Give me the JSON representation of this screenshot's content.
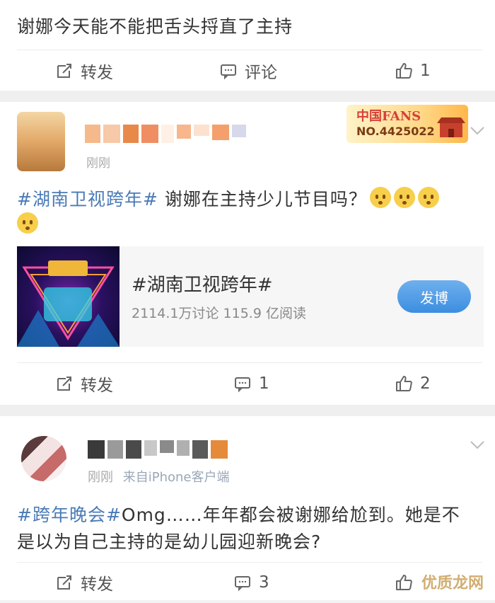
{
  "post1": {
    "text": "谢娜今天能不能把舌头捋直了主持",
    "actions": {
      "repost": "转发",
      "comment": "评论",
      "like": "1"
    }
  },
  "post2": {
    "time": "刚刚",
    "badge": {
      "brand": "中国FANS",
      "number": "NO.4425022"
    },
    "topic": "#湖南卫视跨年#",
    "text": " 谢娜在主持少儿节目吗？",
    "topic_card": {
      "title": "#湖南卫视跨年#",
      "stats": "2114.1万讨论  115.9 亿阅读",
      "button": "发博"
    },
    "actions": {
      "repost": "转发",
      "comment": "1",
      "like": "2"
    }
  },
  "post3": {
    "time": "刚刚",
    "source": "来自iPhone客户端",
    "topic": "#跨年晚会#",
    "text_line1_rest": "Omg……年年都会被谢娜给尬到。她是不",
    "text_line2": "是以为自己主持的是幼儿园迎新晚会?",
    "actions": {
      "repost": "转发",
      "comment": "3"
    }
  },
  "watermark": "优质龙网",
  "colors": {
    "topic": "#4a7ab6",
    "button": "#3c8ee0",
    "badge_red": "#d6403a"
  },
  "icons": [
    "repost-icon",
    "comment-icon",
    "like-icon",
    "chevron-down-icon",
    "emoji-icon"
  ]
}
